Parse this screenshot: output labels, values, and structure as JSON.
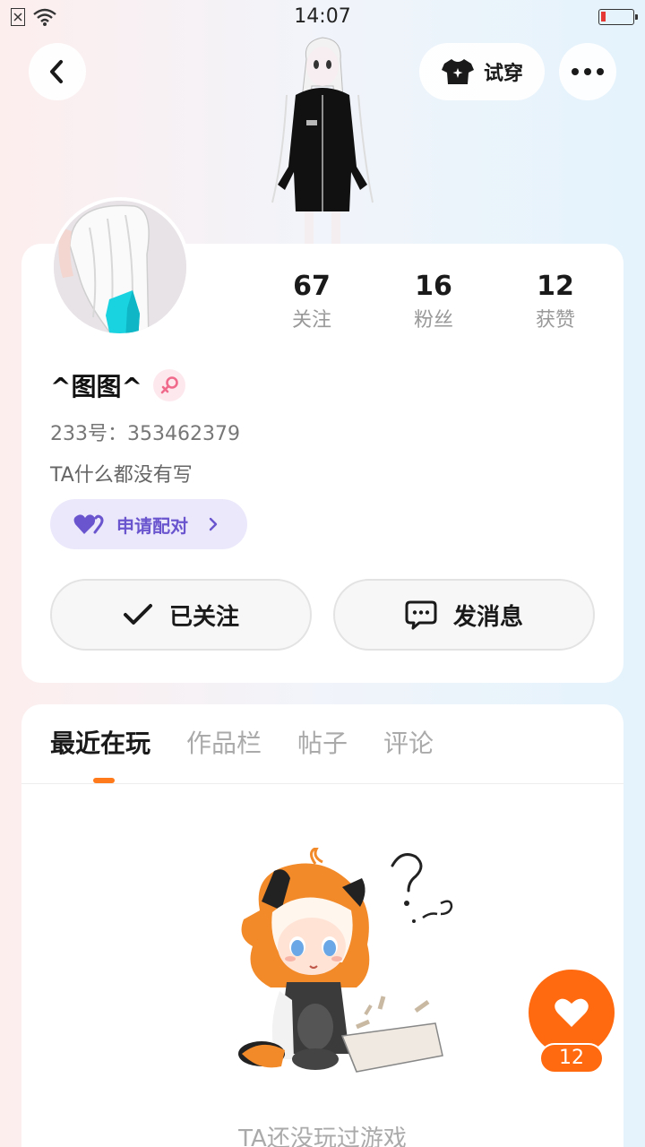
{
  "status_bar": {
    "time": "14:07",
    "battery_level": 0.15,
    "battery_color": "#e53935"
  },
  "nav": {
    "back_icon": "chevron-left-icon",
    "tryon_label": "试穿",
    "tryon_icon": "shirt-icon",
    "more_icon": "more-dots-icon"
  },
  "profile": {
    "stats": [
      {
        "value": "67",
        "label": "关注"
      },
      {
        "value": "16",
        "label": "粉丝"
      },
      {
        "value": "12",
        "label": "获赞"
      }
    ],
    "username": "^图图^",
    "gender_icon": "female-icon",
    "gender_color": "#f06a8c",
    "uid": "233号：353462379",
    "bio": "TA什么都没有写",
    "pair_button": "申请配对",
    "follow_button": "已关注",
    "message_button": "发消息"
  },
  "tabs": {
    "items": [
      "最近在玩",
      "作品栏",
      "帖子",
      "评论"
    ],
    "active_index": 0,
    "accent": "#ff7a1a"
  },
  "empty_state": {
    "text": "TA还没玩过游戏"
  },
  "like_fab": {
    "icon": "heart-icon",
    "count": "12",
    "color": "#ff6a10"
  }
}
